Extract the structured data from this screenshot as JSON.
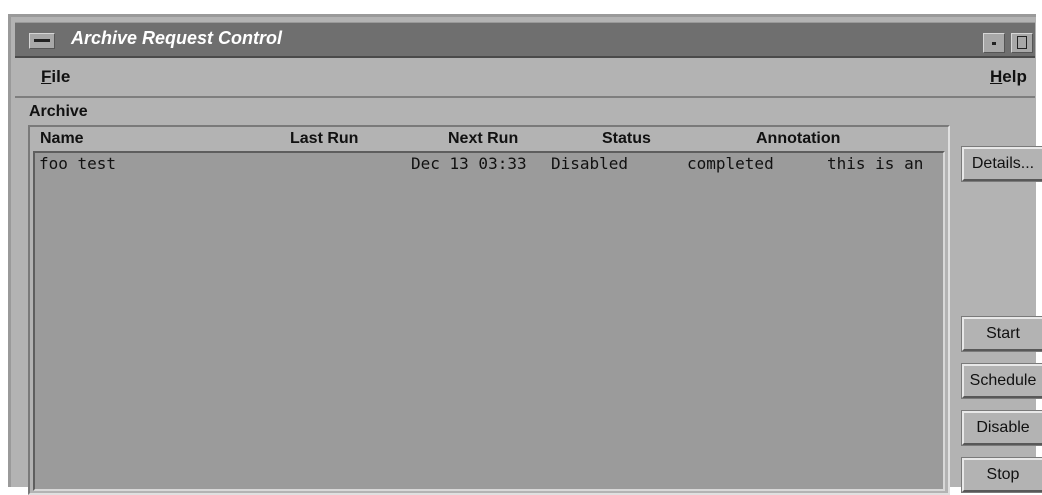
{
  "window": {
    "title": "Archive Request Control"
  },
  "menubar": {
    "file_rest": "ile",
    "file_first": "F",
    "help_first": "H",
    "help_rest": "elp"
  },
  "section": {
    "label": "Archive"
  },
  "table": {
    "columns": [
      "Name",
      "Last Run",
      "Next Run",
      "Status",
      "Annotation"
    ],
    "rows": [
      {
        "name": "foo test",
        "last_run": "",
        "next_run": "Dec 13 03:33",
        "status": "Disabled",
        "state": "completed",
        "annotation": "this is an"
      }
    ]
  },
  "buttons": {
    "details": "Details...",
    "start": "Start",
    "schedule": "Schedule",
    "disable": "Disable",
    "stop": "Stop"
  },
  "colors": {
    "window_bg": "#b3b3b3",
    "titlebar_bg": "#6f6f6f",
    "list_bg": "#9b9b9b"
  },
  "icons": [
    "window-menu-icon",
    "minimize-icon",
    "maximize-icon"
  ]
}
